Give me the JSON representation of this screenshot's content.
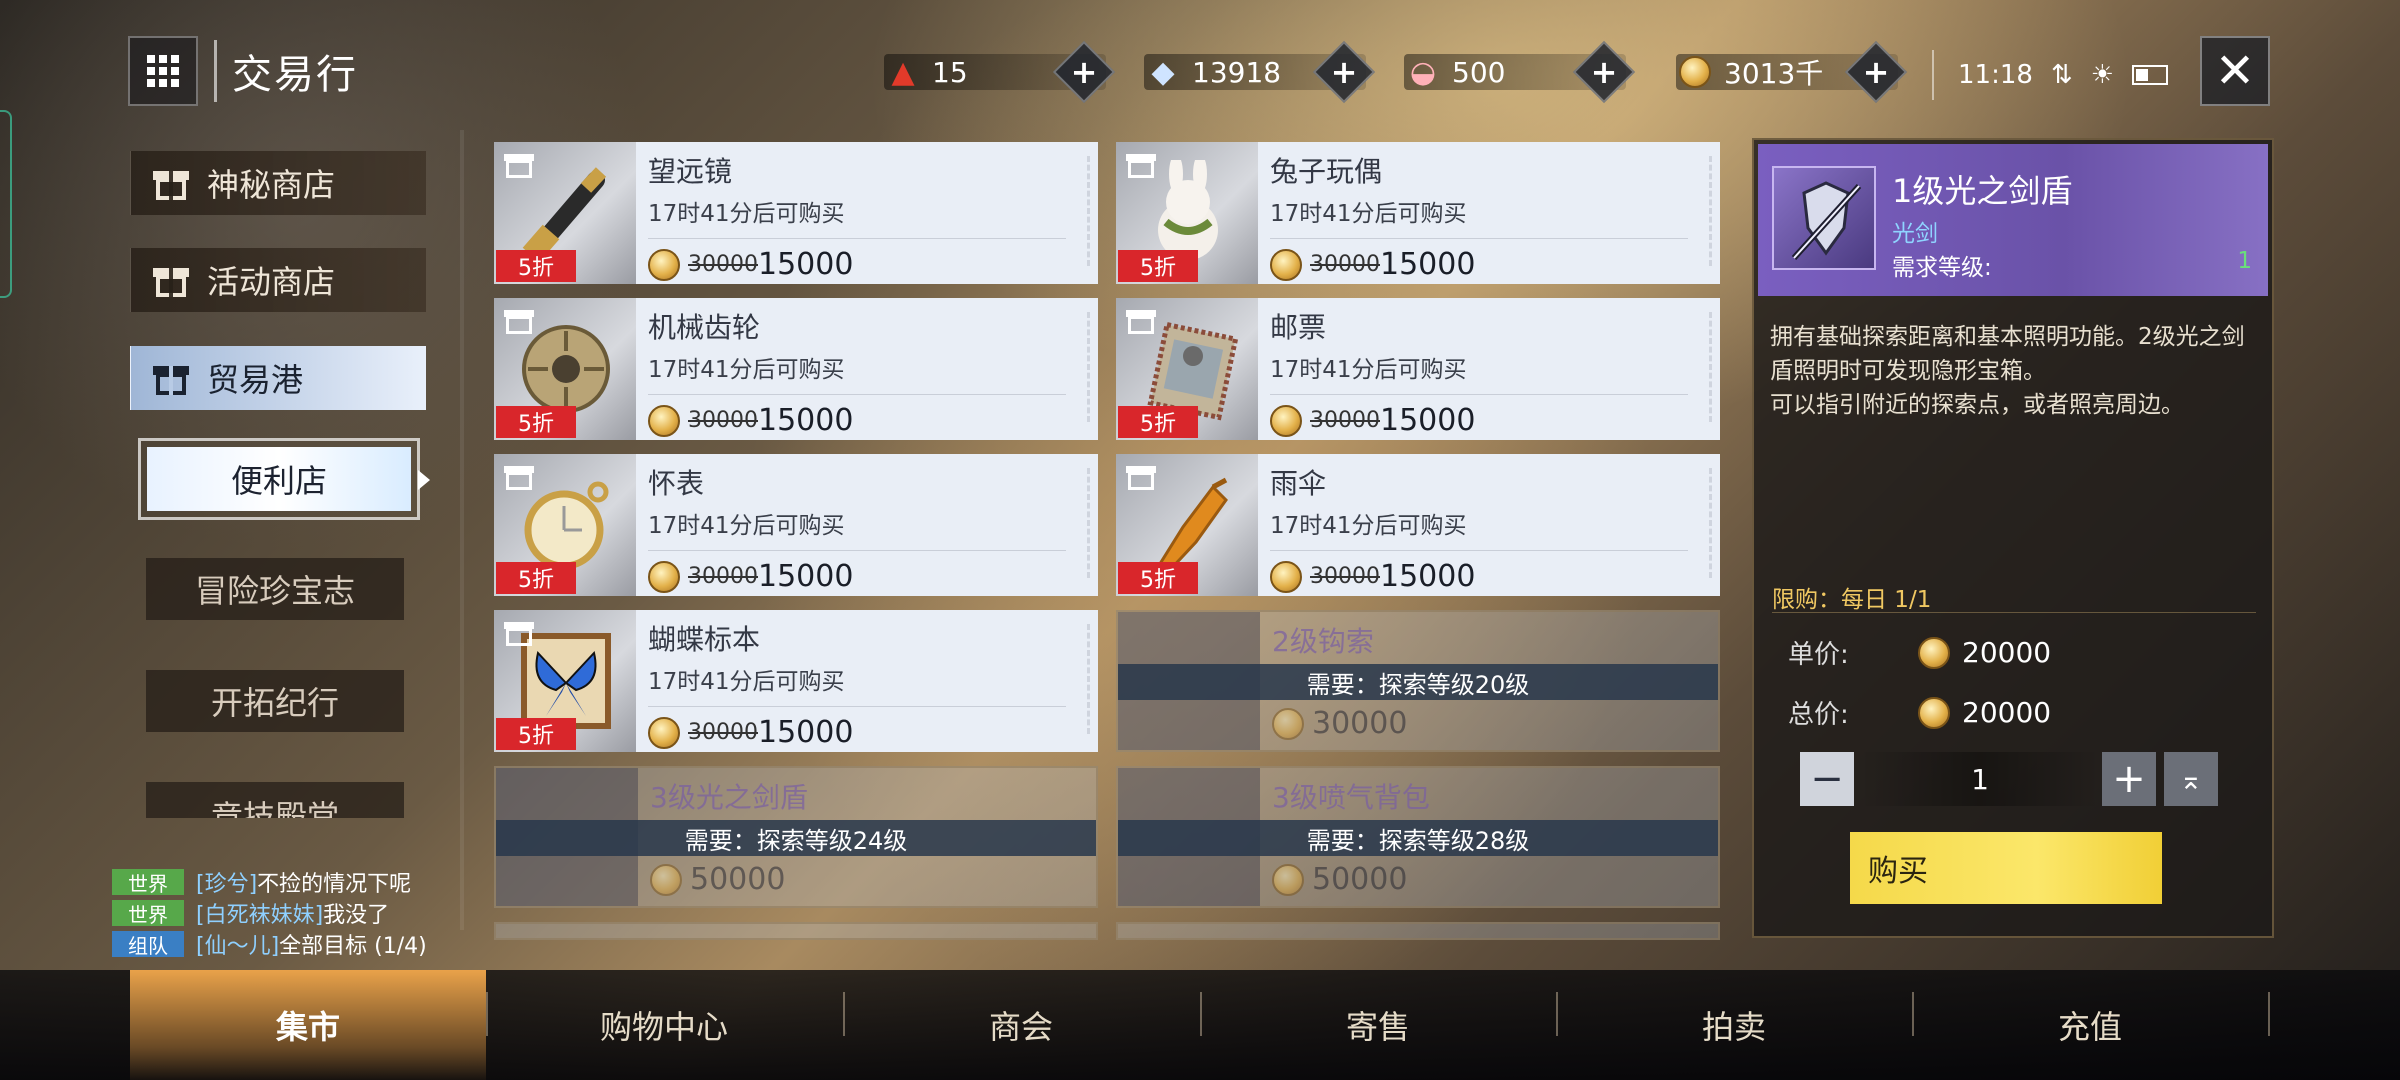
{
  "header": {
    "title": "交易行"
  },
  "currencies": [
    {
      "icon": "red-crystal-icon",
      "value": "15",
      "glyph": "▲",
      "color": "#e23a2a"
    },
    {
      "icon": "diamond-icon",
      "value": "13918",
      "glyph": "◆",
      "color": "#cfe4ff"
    },
    {
      "icon": "shell-icon",
      "value": "500",
      "glyph": "◒",
      "color": "#ffb1b8"
    },
    {
      "icon": "gold-coin-icon",
      "value": "3013千",
      "glyph": "",
      "color": "#e3b14a"
    }
  ],
  "status": {
    "time": "11:18"
  },
  "nav": {
    "shops": [
      {
        "label": "神秘商店"
      },
      {
        "label": "活动商店"
      },
      {
        "label": "贸易港"
      }
    ],
    "sub_active": "便利店",
    "subs": [
      {
        "label": "冒险珍宝志"
      },
      {
        "label": "开拓纪行"
      },
      {
        "label": "竞技殿堂"
      }
    ]
  },
  "items": [
    {
      "name": "望远镜",
      "timer": "17时41分后可购买",
      "old": "30000",
      "price": "15000",
      "discount": "5折"
    },
    {
      "name": "兔子玩偶",
      "timer": "17时41分后可购买",
      "old": "30000",
      "price": "15000",
      "discount": "5折"
    },
    {
      "name": "机械齿轮",
      "timer": "17时41分后可购买",
      "old": "30000",
      "price": "15000",
      "discount": "5折"
    },
    {
      "name": "邮票",
      "timer": "17时41分后可购买",
      "old": "30000",
      "price": "15000",
      "discount": "5折"
    },
    {
      "name": "怀表",
      "timer": "17时41分后可购买",
      "old": "30000",
      "price": "15000",
      "discount": "5折"
    },
    {
      "name": "雨伞",
      "timer": "17时41分后可购买",
      "old": "30000",
      "price": "15000",
      "discount": "5折"
    },
    {
      "name": "蝴蝶标本",
      "timer": "17时41分后可购买",
      "old": "30000",
      "price": "15000",
      "discount": "5折"
    }
  ],
  "locked": [
    {
      "name": "2级钩索",
      "req": "需要：探索等级20级",
      "price": "30000"
    },
    {
      "name": "3级光之剑盾",
      "req": "需要：探索等级24级",
      "price": "50000"
    },
    {
      "name": "3级喷气背包",
      "req": "需要：探索等级28级",
      "price": "50000"
    }
  ],
  "detail": {
    "name": "1级光之剑盾",
    "type": "光剑",
    "req_label": "需求等级:",
    "req_value": "1",
    "desc": "拥有基础探索距离和基本照明功能。2级光之剑盾照明时可发现隐形宝箱。\n可以指引附近的探索点，或者照亮周边。",
    "limit": "限购：每日 1/1",
    "unit_label": "单价:",
    "unit_price": "20000",
    "total_label": "总价:",
    "total_price": "20000",
    "quantity": "1",
    "buy_label": "购买"
  },
  "chat": [
    {
      "channel": "世界",
      "who": "[珍兮]",
      "text": "不捡的情况下呢"
    },
    {
      "channel": "世界",
      "who": "[白死袜妹妹]",
      "text": "我没了"
    },
    {
      "channel": "组队",
      "who": "[仙～儿]",
      "text": "全部目标 (1/4)"
    }
  ],
  "tabs": [
    {
      "label": "集市"
    },
    {
      "label": "购物中心"
    },
    {
      "label": "商会"
    },
    {
      "label": "寄售"
    },
    {
      "label": "拍卖"
    },
    {
      "label": "充值"
    }
  ]
}
